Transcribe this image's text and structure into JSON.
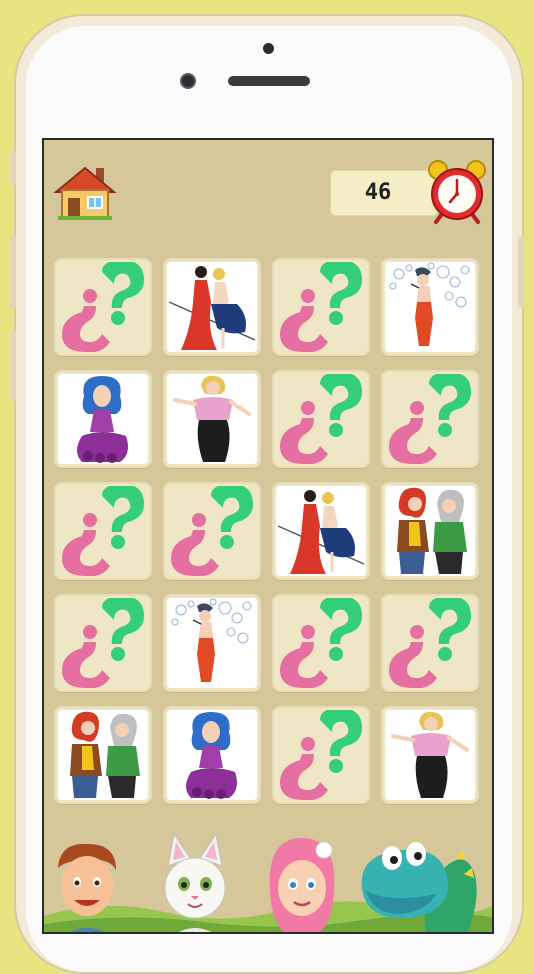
{
  "game": {
    "timer_value": "46"
  },
  "icons": {
    "home": "house-icon",
    "clock": "alarm-clock-icon"
  },
  "colors": {
    "background": "#e6e57f",
    "board": "#d6c79a",
    "card": "#eee6c5",
    "question_pink": "#e66fa2",
    "question_green": "#35cf7a"
  },
  "cards": [
    {
      "state": "hidden"
    },
    {
      "state": "revealed",
      "image": "two-women-dancing"
    },
    {
      "state": "hidden"
    },
    {
      "state": "revealed",
      "image": "woman-blowing-bubbles"
    },
    {
      "state": "revealed",
      "image": "woman-blue-hair-purple-dress"
    },
    {
      "state": "revealed",
      "image": "blonde-woman-pink-top"
    },
    {
      "state": "hidden"
    },
    {
      "state": "hidden"
    },
    {
      "state": "hidden"
    },
    {
      "state": "hidden"
    },
    {
      "state": "revealed",
      "image": "two-women-dancing"
    },
    {
      "state": "revealed",
      "image": "two-friends-redhead-grey-hair"
    },
    {
      "state": "hidden"
    },
    {
      "state": "revealed",
      "image": "woman-blowing-bubbles"
    },
    {
      "state": "hidden"
    },
    {
      "state": "hidden"
    },
    {
      "state": "revealed",
      "image": "two-friends-redhead-grey-hair"
    },
    {
      "state": "revealed",
      "image": "woman-blue-hair-purple-dress"
    },
    {
      "state": "hidden"
    },
    {
      "state": "revealed",
      "image": "blonde-woman-pink-top"
    }
  ],
  "bottom_characters": [
    "boy",
    "white-cat",
    "pink-haired-girl",
    "green-dragon"
  ]
}
